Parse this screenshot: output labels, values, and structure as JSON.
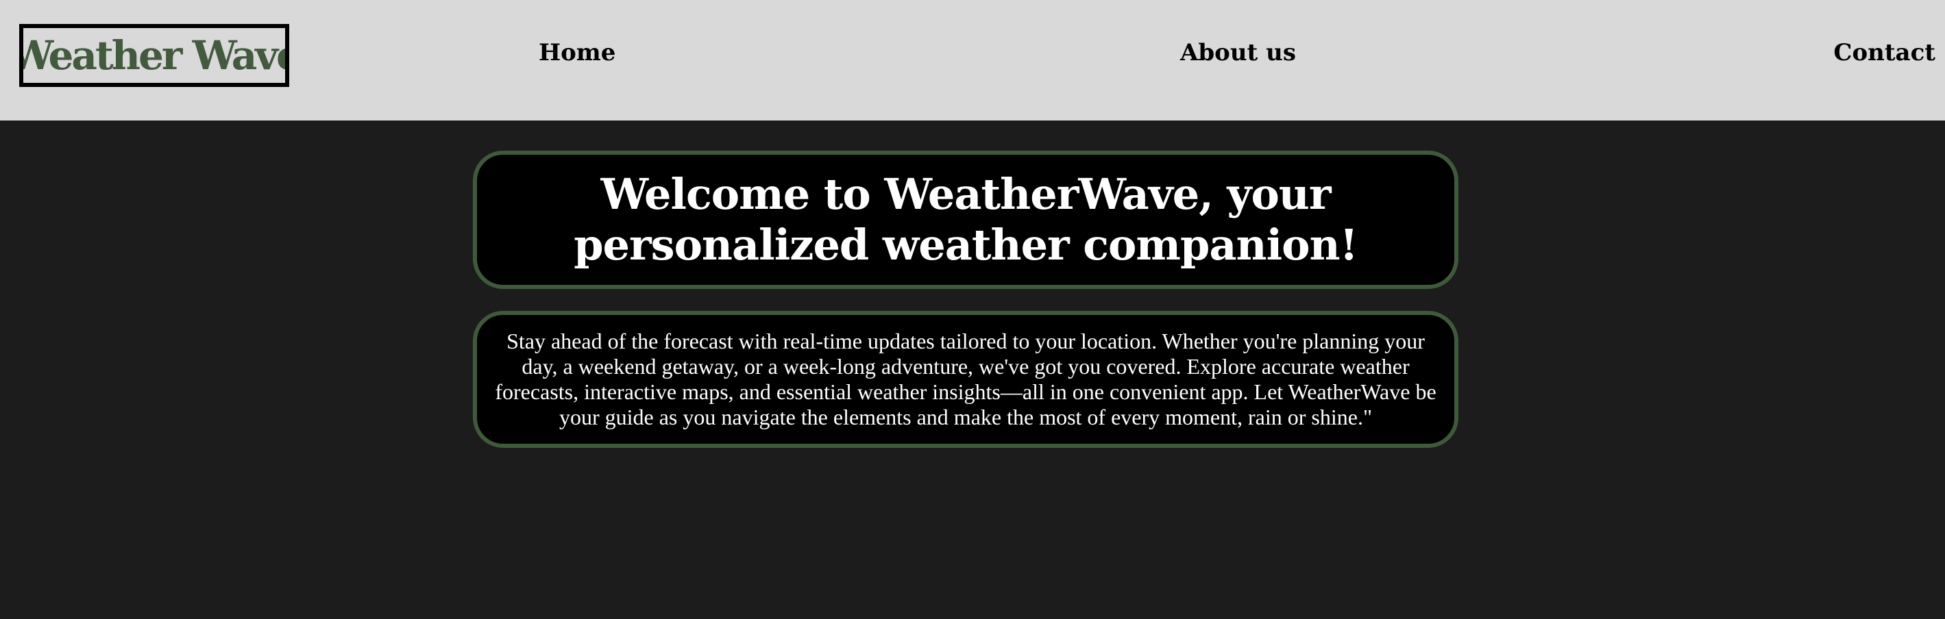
{
  "header": {
    "logo_text": "Weather Wave",
    "nav": {
      "home": "Home",
      "about": "About us",
      "contact": "Contact"
    }
  },
  "main": {
    "welcome_heading": "Welcome to WeatherWave, your personalized weather companion!",
    "intro_text": "Stay ahead of the forecast with real-time updates tailored to your location. Whether you're planning your day, a weekend getaway, or a week-long adventure, we've got you covered. Explore accurate weather forecasts, interactive maps, and essential weather insights—all in one convenient app. Let WeatherWave be your guide as you navigate the elements and make the most of every moment, rain or shine.\""
  },
  "colors": {
    "header_bg": "#d9d9d9",
    "page_bg": "#1c1c1c",
    "brand_green": "#435a3f",
    "panel_border": "#3f5a3b",
    "panel_bg": "#000000",
    "text_light": "#ffffff"
  }
}
